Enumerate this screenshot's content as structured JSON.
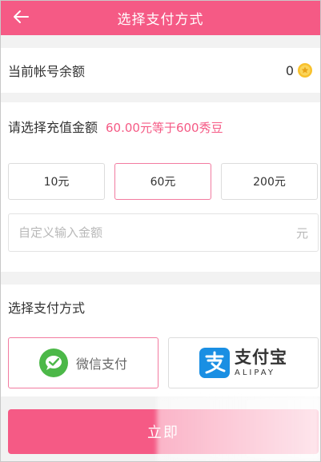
{
  "header": {
    "title": "选择支付方式",
    "back_icon": "back-arrow-icon"
  },
  "balance": {
    "label": "当前帐号余额",
    "value": "0",
    "icon": "coin-icon"
  },
  "recharge": {
    "title": "请选择充值金额",
    "hint": "60.00元等于600秀豆",
    "options": [
      "10元",
      "60元",
      "200元"
    ],
    "selected_index": 1,
    "custom_placeholder": "自定义输入金额",
    "custom_unit": "元"
  },
  "payment": {
    "title": "选择支付方式",
    "methods": [
      {
        "name": "wechat",
        "label": "微信支付",
        "icon": "wechat-icon",
        "selected": true
      },
      {
        "name": "alipay",
        "label": "支付宝",
        "sublabel": "ALIPAY",
        "icon": "alipay-icon",
        "selected": false
      }
    ]
  },
  "submit": {
    "label": "立即"
  },
  "colors": {
    "accent": "#f55a85",
    "selected_border": "#f27ba0",
    "wechat": "#4cb848",
    "alipay": "#1a8fe3",
    "coin": "#f8c12d"
  }
}
